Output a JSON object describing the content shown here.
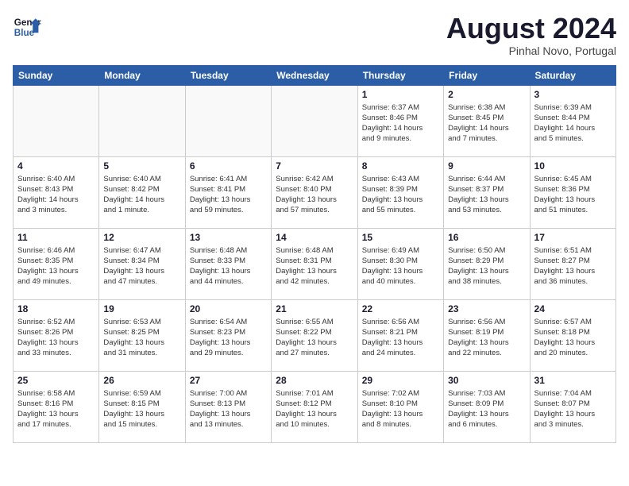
{
  "header": {
    "logo_line1": "General",
    "logo_line2": "Blue",
    "month_year": "August 2024",
    "location": "Pinhal Novo, Portugal"
  },
  "weekdays": [
    "Sunday",
    "Monday",
    "Tuesday",
    "Wednesday",
    "Thursday",
    "Friday",
    "Saturday"
  ],
  "weeks": [
    [
      {
        "day": "",
        "info": ""
      },
      {
        "day": "",
        "info": ""
      },
      {
        "day": "",
        "info": ""
      },
      {
        "day": "",
        "info": ""
      },
      {
        "day": "1",
        "info": "Sunrise: 6:37 AM\nSunset: 8:46 PM\nDaylight: 14 hours\nand 9 minutes."
      },
      {
        "day": "2",
        "info": "Sunrise: 6:38 AM\nSunset: 8:45 PM\nDaylight: 14 hours\nand 7 minutes."
      },
      {
        "day": "3",
        "info": "Sunrise: 6:39 AM\nSunset: 8:44 PM\nDaylight: 14 hours\nand 5 minutes."
      }
    ],
    [
      {
        "day": "4",
        "info": "Sunrise: 6:40 AM\nSunset: 8:43 PM\nDaylight: 14 hours\nand 3 minutes."
      },
      {
        "day": "5",
        "info": "Sunrise: 6:40 AM\nSunset: 8:42 PM\nDaylight: 14 hours\nand 1 minute."
      },
      {
        "day": "6",
        "info": "Sunrise: 6:41 AM\nSunset: 8:41 PM\nDaylight: 13 hours\nand 59 minutes."
      },
      {
        "day": "7",
        "info": "Sunrise: 6:42 AM\nSunset: 8:40 PM\nDaylight: 13 hours\nand 57 minutes."
      },
      {
        "day": "8",
        "info": "Sunrise: 6:43 AM\nSunset: 8:39 PM\nDaylight: 13 hours\nand 55 minutes."
      },
      {
        "day": "9",
        "info": "Sunrise: 6:44 AM\nSunset: 8:37 PM\nDaylight: 13 hours\nand 53 minutes."
      },
      {
        "day": "10",
        "info": "Sunrise: 6:45 AM\nSunset: 8:36 PM\nDaylight: 13 hours\nand 51 minutes."
      }
    ],
    [
      {
        "day": "11",
        "info": "Sunrise: 6:46 AM\nSunset: 8:35 PM\nDaylight: 13 hours\nand 49 minutes."
      },
      {
        "day": "12",
        "info": "Sunrise: 6:47 AM\nSunset: 8:34 PM\nDaylight: 13 hours\nand 47 minutes."
      },
      {
        "day": "13",
        "info": "Sunrise: 6:48 AM\nSunset: 8:33 PM\nDaylight: 13 hours\nand 44 minutes."
      },
      {
        "day": "14",
        "info": "Sunrise: 6:48 AM\nSunset: 8:31 PM\nDaylight: 13 hours\nand 42 minutes."
      },
      {
        "day": "15",
        "info": "Sunrise: 6:49 AM\nSunset: 8:30 PM\nDaylight: 13 hours\nand 40 minutes."
      },
      {
        "day": "16",
        "info": "Sunrise: 6:50 AM\nSunset: 8:29 PM\nDaylight: 13 hours\nand 38 minutes."
      },
      {
        "day": "17",
        "info": "Sunrise: 6:51 AM\nSunset: 8:27 PM\nDaylight: 13 hours\nand 36 minutes."
      }
    ],
    [
      {
        "day": "18",
        "info": "Sunrise: 6:52 AM\nSunset: 8:26 PM\nDaylight: 13 hours\nand 33 minutes."
      },
      {
        "day": "19",
        "info": "Sunrise: 6:53 AM\nSunset: 8:25 PM\nDaylight: 13 hours\nand 31 minutes."
      },
      {
        "day": "20",
        "info": "Sunrise: 6:54 AM\nSunset: 8:23 PM\nDaylight: 13 hours\nand 29 minutes."
      },
      {
        "day": "21",
        "info": "Sunrise: 6:55 AM\nSunset: 8:22 PM\nDaylight: 13 hours\nand 27 minutes."
      },
      {
        "day": "22",
        "info": "Sunrise: 6:56 AM\nSunset: 8:21 PM\nDaylight: 13 hours\nand 24 minutes."
      },
      {
        "day": "23",
        "info": "Sunrise: 6:56 AM\nSunset: 8:19 PM\nDaylight: 13 hours\nand 22 minutes."
      },
      {
        "day": "24",
        "info": "Sunrise: 6:57 AM\nSunset: 8:18 PM\nDaylight: 13 hours\nand 20 minutes."
      }
    ],
    [
      {
        "day": "25",
        "info": "Sunrise: 6:58 AM\nSunset: 8:16 PM\nDaylight: 13 hours\nand 17 minutes."
      },
      {
        "day": "26",
        "info": "Sunrise: 6:59 AM\nSunset: 8:15 PM\nDaylight: 13 hours\nand 15 minutes."
      },
      {
        "day": "27",
        "info": "Sunrise: 7:00 AM\nSunset: 8:13 PM\nDaylight: 13 hours\nand 13 minutes."
      },
      {
        "day": "28",
        "info": "Sunrise: 7:01 AM\nSunset: 8:12 PM\nDaylight: 13 hours\nand 10 minutes."
      },
      {
        "day": "29",
        "info": "Sunrise: 7:02 AM\nSunset: 8:10 PM\nDaylight: 13 hours\nand 8 minutes."
      },
      {
        "day": "30",
        "info": "Sunrise: 7:03 AM\nSunset: 8:09 PM\nDaylight: 13 hours\nand 6 minutes."
      },
      {
        "day": "31",
        "info": "Sunrise: 7:04 AM\nSunset: 8:07 PM\nDaylight: 13 hours\nand 3 minutes."
      }
    ]
  ]
}
